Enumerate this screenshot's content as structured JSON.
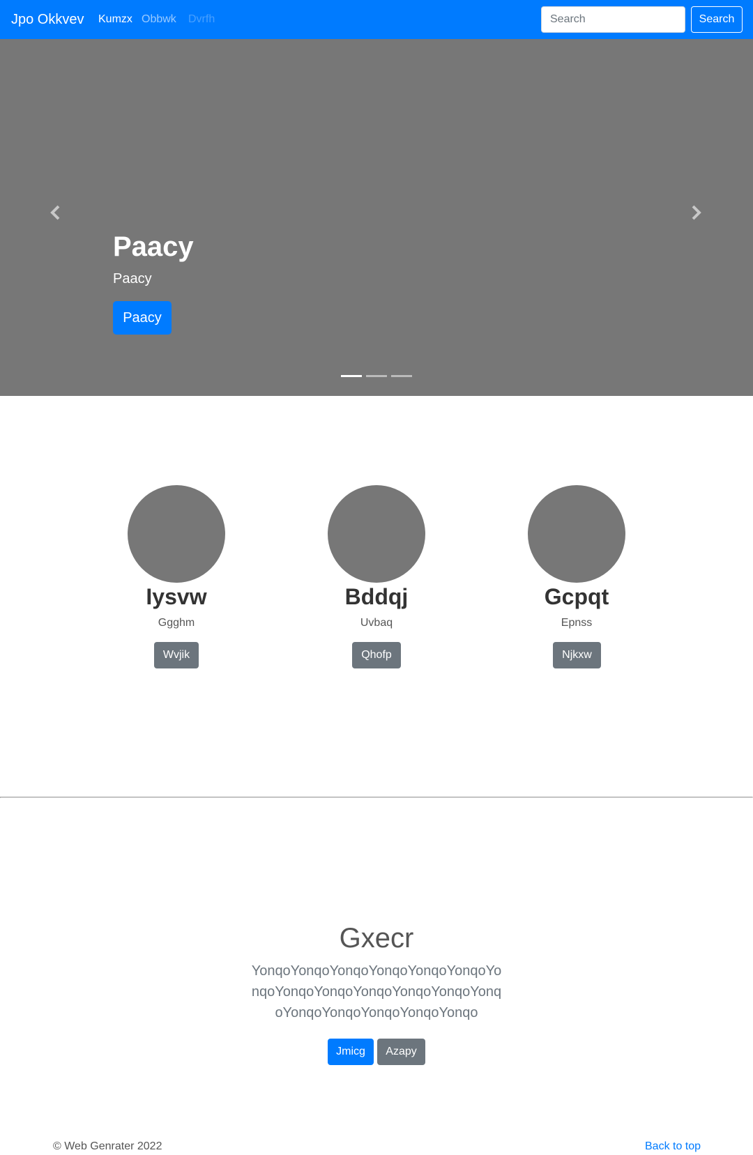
{
  "navbar": {
    "brand": "Jpo Okkvev",
    "links": [
      {
        "label": "Kumzx"
      },
      {
        "label": "Obbwk"
      },
      {
        "label": "Dvrfh"
      }
    ],
    "search": {
      "placeholder": "Search",
      "button_label": "Search"
    }
  },
  "carousel": {
    "title": "Paacy",
    "text": "Paacy",
    "button_label": "Paacy",
    "active_index": 0,
    "slide_count": 3
  },
  "marketing": {
    "columns": [
      {
        "heading": "Iysvw",
        "text": "Ggghm",
        "button_label": "Wvjik"
      },
      {
        "heading": "Bddqj",
        "text": "Uvbaq",
        "button_label": "Qhofp"
      },
      {
        "heading": "Gcpqt",
        "text": "Epnss",
        "button_label": "Njkxw"
      }
    ]
  },
  "feature": {
    "heading": "Gxecr",
    "body": "YonqoYonqoYonqoYonqoYonqoYonqoYonqoYonqoYonqoYonqoYonqoYonqoYonqoYonqoYonqoYonqoYonqoYonqo",
    "primary_label": "Jmicg",
    "secondary_label": "Azapy"
  },
  "footer": {
    "copyright": "© Web Genrater 2022",
    "back_to_top": "Back to top"
  },
  "colors": {
    "primary": "#007bff",
    "secondary": "#6c757d",
    "placeholder_gray": "#777777"
  }
}
